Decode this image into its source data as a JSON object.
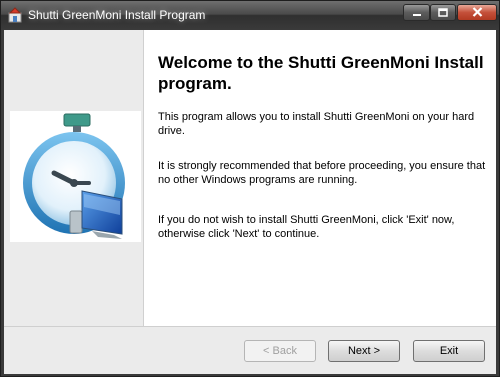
{
  "window": {
    "title": "Shutti GreenMoni Install Program"
  },
  "content": {
    "heading": "Welcome to the Shutti GreenMoni Install program.",
    "paragraph1": "This program allows you to install Shutti GreenMoni on your hard drive.",
    "paragraph2": "It is strongly recommended that before proceeding, you ensure that no other Windows programs are running.",
    "paragraph3": "If you do not wish to install Shutti GreenMoni, click 'Exit' now, otherwise click 'Next' to continue."
  },
  "buttons": {
    "back": "< Back",
    "next": "Next >",
    "exit": "Exit"
  },
  "icons": {
    "app": "installer-icon",
    "hero": "stopwatch-computer-icon",
    "minimize": "minimize-icon",
    "maximize": "maximize-icon",
    "close": "close-icon"
  },
  "colors": {
    "titlebar": "#3a3a3a",
    "close_button": "#c4503a",
    "panel": "#ebebeb"
  },
  "state": {
    "back_enabled": false
  }
}
